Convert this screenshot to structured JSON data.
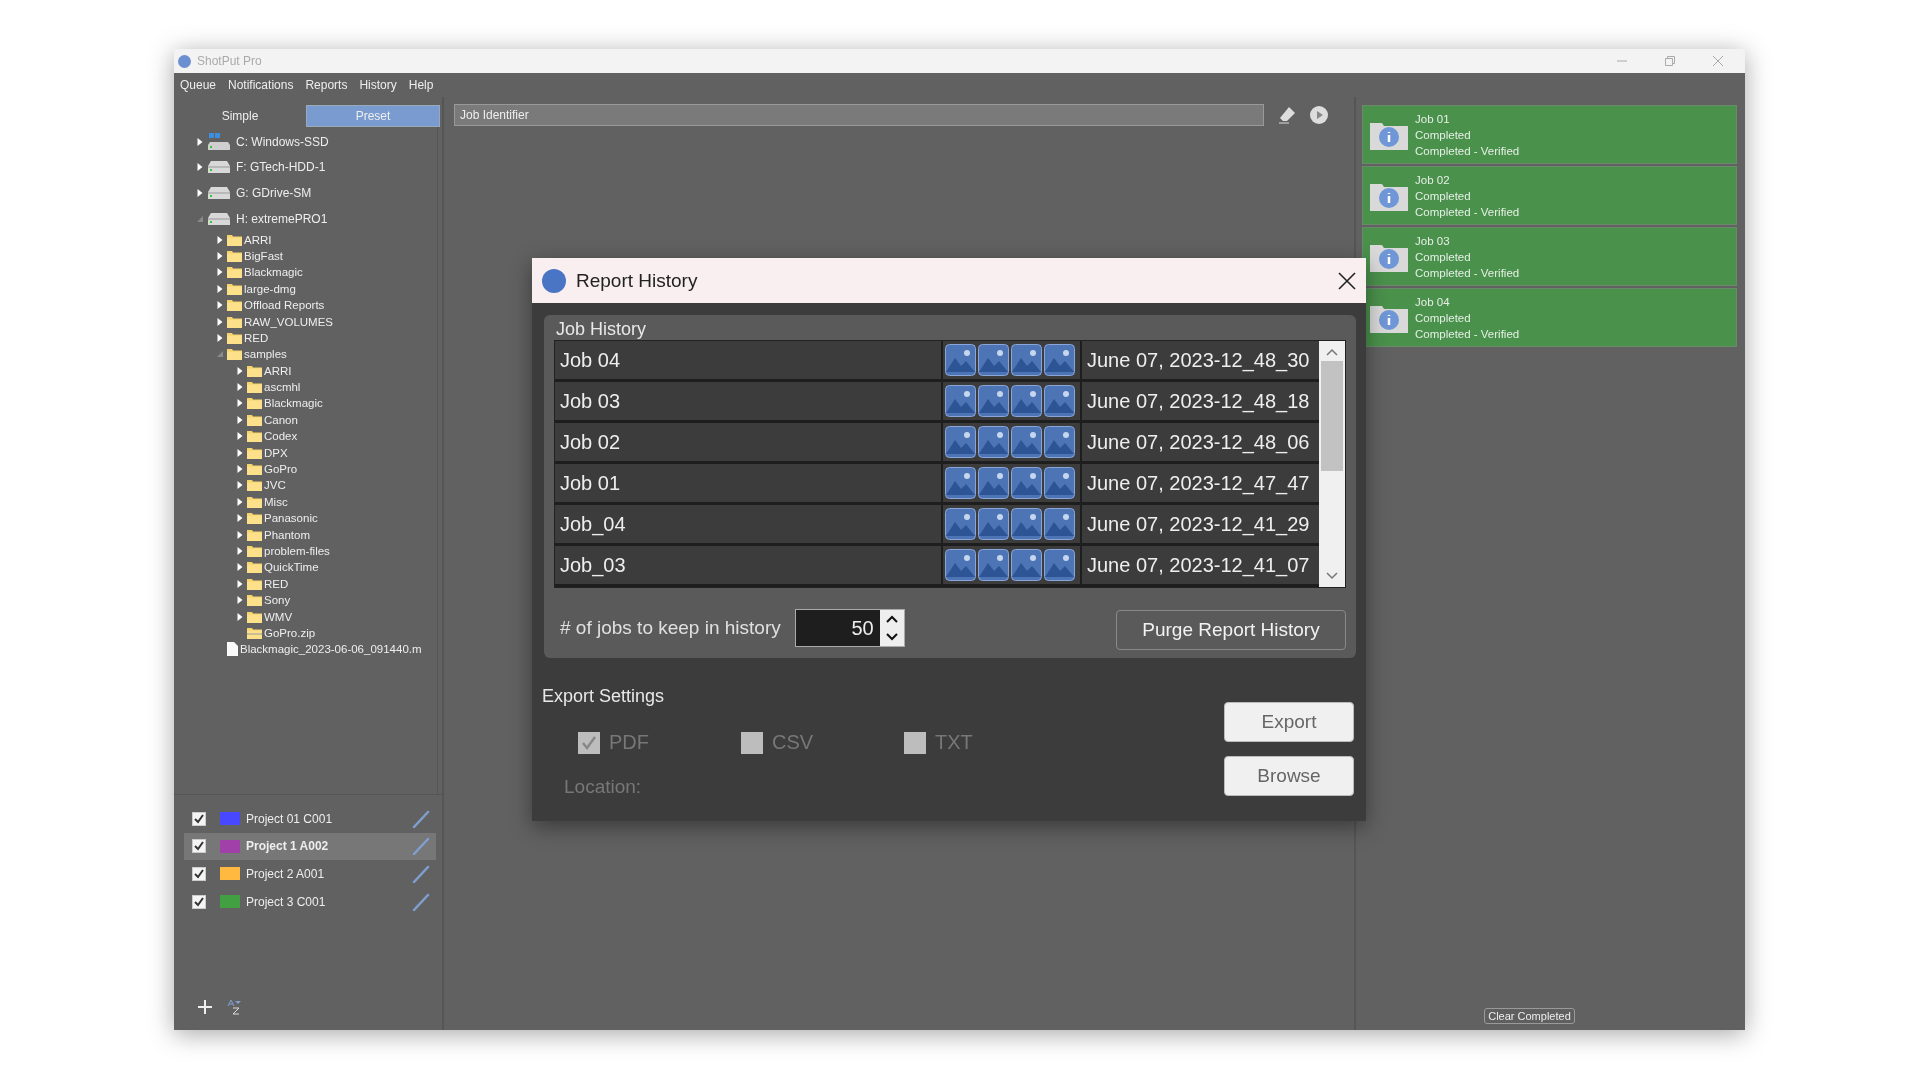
{
  "window": {
    "title": "ShotPut Pro"
  },
  "menu": [
    "Queue",
    "Notifications",
    "Reports",
    "History",
    "Help"
  ],
  "mode_tabs": [
    {
      "label": "Simple",
      "selected": false
    },
    {
      "label": "Preset",
      "selected": true
    }
  ],
  "tree": [
    {
      "label": "C: Windows-SSD",
      "kind": "system_drive",
      "expanded": false
    },
    {
      "label": "F: GTech-HDD-1",
      "kind": "drive",
      "expanded": false
    },
    {
      "label": "G: GDrive-SM",
      "kind": "drive",
      "expanded": false
    },
    {
      "label": "H: extremePRO1",
      "kind": "drive",
      "expanded": true,
      "children": [
        {
          "label": "ARRI",
          "kind": "folder",
          "expanded": false
        },
        {
          "label": "BigFast",
          "kind": "folder",
          "expanded": false
        },
        {
          "label": "Blackmagic",
          "kind": "folder",
          "expanded": false
        },
        {
          "label": "large-dmg",
          "kind": "folder",
          "expanded": false
        },
        {
          "label": "Offload Reports",
          "kind": "folder",
          "expanded": false
        },
        {
          "label": "RAW_VOLUMES",
          "kind": "folder",
          "expanded": false
        },
        {
          "label": "RED",
          "kind": "folder",
          "expanded": false
        },
        {
          "label": "samples",
          "kind": "folder",
          "expanded": true,
          "children": [
            {
              "label": "ARRI",
              "kind": "folder",
              "expanded": false
            },
            {
              "label": "ascmhl",
              "kind": "folder",
              "expanded": false
            },
            {
              "label": "Blackmagic",
              "kind": "folder",
              "expanded": false
            },
            {
              "label": "Canon",
              "kind": "folder",
              "expanded": false
            },
            {
              "label": "Codex",
              "kind": "folder",
              "expanded": false
            },
            {
              "label": "DPX",
              "kind": "folder",
              "expanded": false
            },
            {
              "label": "GoPro",
              "kind": "folder",
              "expanded": false
            },
            {
              "label": "JVC",
              "kind": "folder",
              "expanded": false
            },
            {
              "label": "Misc",
              "kind": "folder",
              "expanded": false
            },
            {
              "label": "Panasonic",
              "kind": "folder",
              "expanded": false
            },
            {
              "label": "Phantom",
              "kind": "folder",
              "expanded": false
            },
            {
              "label": "problem-files",
              "kind": "folder",
              "expanded": false
            },
            {
              "label": "QuickTime",
              "kind": "folder",
              "expanded": false
            },
            {
              "label": "RED",
              "kind": "folder",
              "expanded": false
            },
            {
              "label": "Sony",
              "kind": "folder",
              "expanded": false
            },
            {
              "label": "WMV",
              "kind": "folder",
              "expanded": false
            },
            {
              "label": "GoPro.zip",
              "kind": "archive"
            }
          ]
        },
        {
          "label": "Blackmagic_2023-06-06_091440.m",
          "kind": "file"
        }
      ]
    }
  ],
  "projects": [
    {
      "label": "Project 01 C001",
      "checked": true,
      "color": "#4848ff",
      "selected": false
    },
    {
      "label": "Project 1 A002",
      "checked": true,
      "color": "#a040a8",
      "selected": true
    },
    {
      "label": "Project 2 A001",
      "checked": true,
      "color": "#ffb940",
      "selected": false
    },
    {
      "label": "Project 3 C001",
      "checked": true,
      "color": "#42a042",
      "selected": false
    }
  ],
  "job_identifier": {
    "placeholder": "Job Identifier"
  },
  "queue": [
    {
      "title": "Job 01",
      "status": "Completed",
      "detail": "Completed - Verified"
    },
    {
      "title": "Job 02",
      "status": "Completed",
      "detail": "Completed - Verified"
    },
    {
      "title": "Job 03",
      "status": "Completed",
      "detail": "Completed - Verified"
    },
    {
      "title": "Job 04",
      "status": "Completed",
      "detail": "Completed - Verified"
    }
  ],
  "clear_button": "Clear Completed",
  "dialog": {
    "title": "Report History",
    "history_title": "Job History",
    "rows": [
      {
        "name": "Job 04",
        "date": "June 07, 2023-12_48_30"
      },
      {
        "name": "Job 03",
        "date": "June 07, 2023-12_48_18"
      },
      {
        "name": "Job 02",
        "date": "June 07, 2023-12_48_06"
      },
      {
        "name": "Job 01",
        "date": "June 07, 2023-12_47_47"
      },
      {
        "name": "Job_04",
        "date": "June 07, 2023-12_41_29"
      },
      {
        "name": "Job_03",
        "date": "June 07, 2023-12_41_07"
      }
    ],
    "keep_label": "# of jobs to keep in history",
    "keep_value": "50",
    "purge_button": "Purge Report History",
    "export_title": "Export Settings",
    "export_disabled": true,
    "formats": [
      {
        "label": "PDF",
        "checked": true
      },
      {
        "label": "CSV",
        "checked": false
      },
      {
        "label": "TXT",
        "checked": false
      }
    ],
    "location_label": "Location:",
    "export_button": "Export",
    "browse_button": "Browse"
  }
}
